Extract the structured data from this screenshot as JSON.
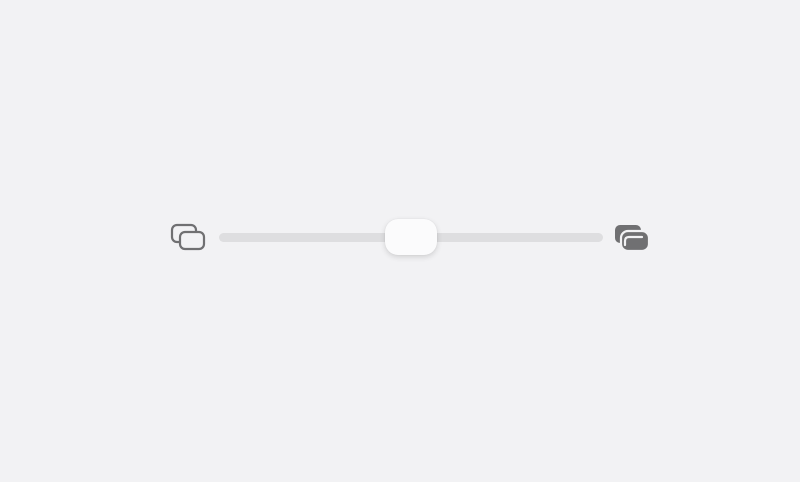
{
  "slider": {
    "value": 0.5,
    "min_icon": "overlapping-windows-outline-icon",
    "max_icon": "overlapping-windows-filled-icon"
  },
  "colors": {
    "background": "#f2f2f4",
    "track": "#dedee0",
    "thumb": "#fbfbfc",
    "icon": "#707072"
  }
}
